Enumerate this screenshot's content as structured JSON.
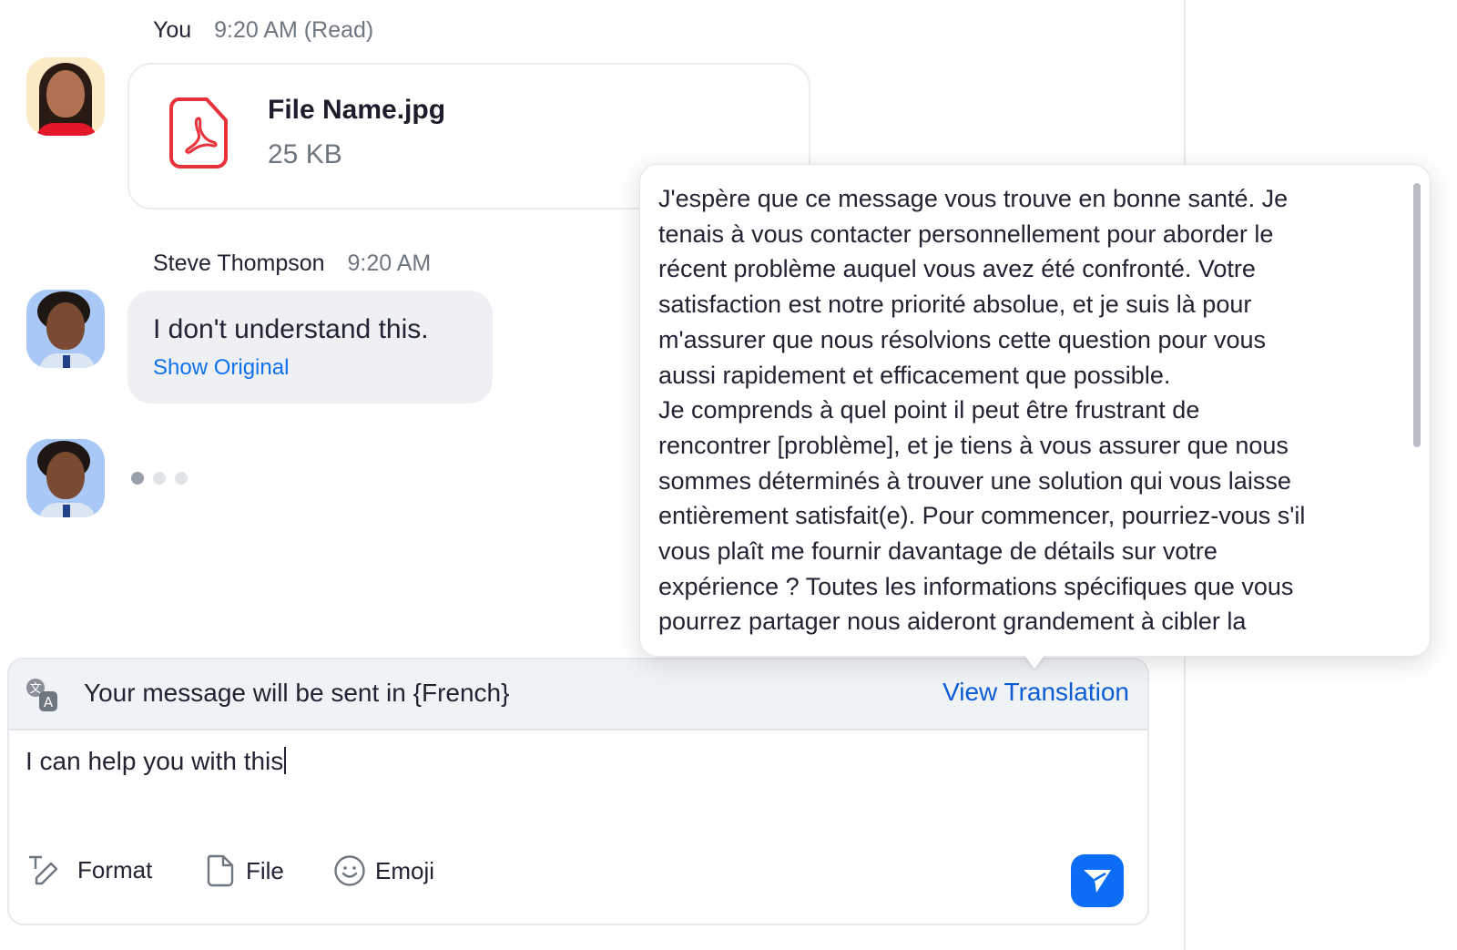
{
  "messages": [
    {
      "sender": "You",
      "time": "9:20 AM (Read)",
      "file": {
        "name": "File Name.jpg",
        "size": "25 KB",
        "icon": "pdf-icon"
      }
    },
    {
      "sender": "Steve Thompson",
      "time": "9:20 AM",
      "text": "I don't understand this.",
      "link": "Show Original"
    },
    {
      "typing": true
    }
  ],
  "translation_popover": {
    "lines": [
      "J'espère que ce message vous trouve en bonne santé. Je",
      "tenais à vous contacter personnellement pour aborder le",
      "récent problème auquel vous avez été confronté. Votre",
      "satisfaction est notre priorité absolue, et je suis là pour",
      "m'assurer que nous résolvions cette question pour vous",
      "aussi rapidement et efficacement que possible.",
      "Je comprends à quel point il peut être frustrant de",
      "rencontrer [problème], et je tiens à vous assurer que nous",
      "sommes déterminés à trouver une solution qui vous laisse",
      "entièrement satisfait(e). Pour commencer, pourriez-vous s'il",
      "vous plaît me fournir davantage de détails sur votre",
      "expérience ? Toutes les informations spécifiques que vous",
      "pourrez partager nous aideront grandement à cibler la"
    ]
  },
  "composer": {
    "translation_notice": "Your message will be sent in {French}",
    "view_translation": "View Translation",
    "input_value": "I can help you with this",
    "toolbar": {
      "format": "Format",
      "file": "File",
      "emoji": "Emoji"
    }
  },
  "colors": {
    "accent": "#0b6cf5",
    "link": "#0e72ed",
    "pdf": "#e8323c"
  }
}
